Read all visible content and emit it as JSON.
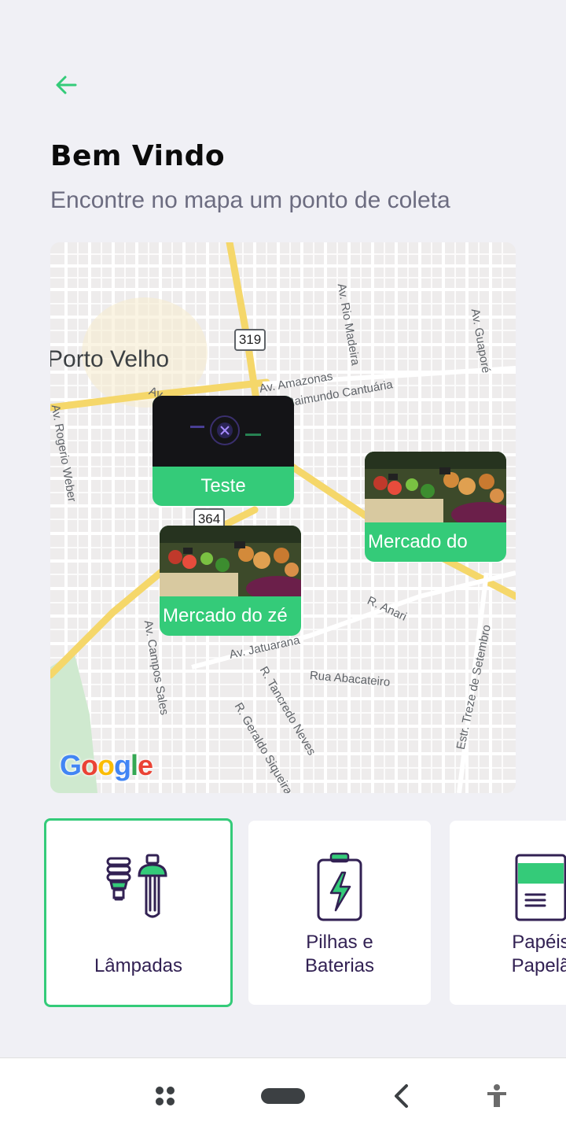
{
  "header": {
    "back_icon": "arrow-left-icon",
    "title": "Bem Vindo",
    "subtitle": "Encontre no mapa um ponto de coleta"
  },
  "map": {
    "city": "Porto Velho",
    "streets": [
      "Av. Rio Madeira",
      "Av. Guaporé",
      "Av. Amazonas",
      "Raimundo Cantuária",
      "Av. Rogerio Weber",
      "Av. Campos Sales",
      "R. Anari",
      "Av. Jatuarana",
      "Rua Abacateiro",
      "R. Tancredo Neves",
      "R. Geraldo Siqueira",
      "Estr. Treze de Setembro",
      "Av."
    ],
    "route_shields": [
      "319",
      "364"
    ],
    "attribution": "Google",
    "markers": [
      {
        "label": "Teste",
        "thumb": "dark-screenshot"
      },
      {
        "label": "Mercado do",
        "thumb": "vegetables-photo"
      },
      {
        "label": "Mercado do zé",
        "thumb": "vegetables-photo"
      }
    ]
  },
  "items": [
    {
      "label": "Lâmpadas",
      "icon": "lamp-icon",
      "selected": true
    },
    {
      "label_line1": "Pilhas e",
      "label_line2": "Baterias",
      "icon": "battery-icon",
      "selected": false
    },
    {
      "label_line1": "Papéis",
      "label_line2": "Papelã",
      "icon": "paper-icon",
      "selected": false
    }
  ],
  "navbar": {
    "buttons": [
      "apps-icon",
      "home-pill-icon",
      "back-chevron-icon",
      "accessibility-icon"
    ]
  },
  "colors": {
    "accent": "#34cb79",
    "title": "#0b0b0b",
    "subtitle": "#6c6c80",
    "item_text": "#322153",
    "background": "#f0f0f5"
  }
}
